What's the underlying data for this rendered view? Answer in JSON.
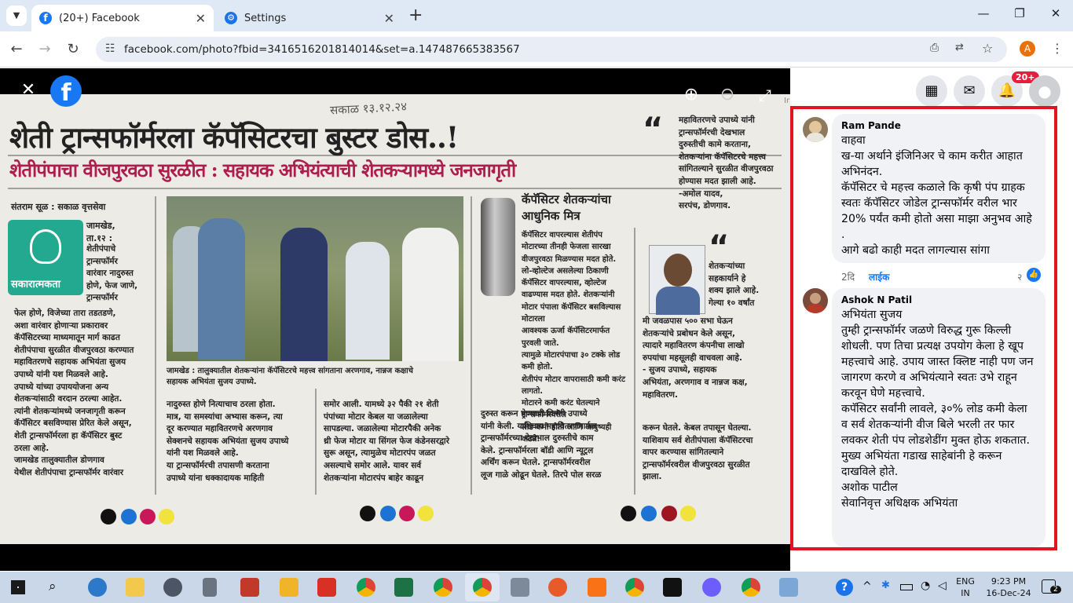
{
  "browser": {
    "tabs": [
      {
        "title": "(20+) Facebook",
        "close": "✕"
      },
      {
        "title": "Settings",
        "close": "✕"
      }
    ],
    "new_tab": "+",
    "url": "facebook.com/photo?fbid=3416516201814014&set=a.147487665383567",
    "profile_initial": "A",
    "window_controls": [
      "—",
      "❐",
      "✕"
    ]
  },
  "viewer": {
    "close": "✕",
    "zoom_in": "⊕",
    "zoom_out": "⊖",
    "expand": "⤢",
    "brand": "f",
    "side_text": "Ir"
  },
  "newspaper": {
    "handwriting": "सकाळ १३.१२.२४",
    "headline": "शेती ट्रान्सफॉर्मरला कॅपॅसिटरचा बुस्टर डोस..!",
    "subheadline": "शेतीपंपाचा वीजपुरवठा सुरळीत : सहायक अभियंत्याची शेतकऱ्यामध्ये जनजागृती",
    "byline": "संतराम सूळ : सकाळ वृत्तसेवा",
    "badge_label": "सकारात्मकता",
    "place": "जामखेड,\nता.१२ :",
    "col1_top": "शेतीपंपाचे\nट्रान्सफॉर्मर\nवारंवार नादुरुस्त\nहोणे, फेज जाणे,\nट्रान्सफॉर्मर",
    "col1_body": "फेल होणे, विजेच्या तारा तडतडणे,\nअशा वारंवार होणाऱ्या प्रकारावर\nकॅपॅसिटरच्या माध्यमातून मार्ग काढत\nशेतीपंपाचा सुरळीत वीजपुरवठा करण्यात\nमहावितरणचे सहायक अभियंता सुजय\nउपाध्ये यांनी यश मिळवले आहे.\nउपाध्ये यांच्या उपाययोजना अन्य\nशेतकऱ्यांसाठी वरदान ठरल्या आहेत.\nत्यांनी शेतकऱ्यांमध्ये जनजागृती करून\nकॅपॅसिटर बसविण्यास प्रेरित केले असून,\nशेती ट्रान्सफॉर्मरला हा कॅपॅसिटर बुस्ट\nठरला आहे.\n   जामखेड तालुक्यातील डोणगाव\nयेथील शेतीपंपाचा ट्रान्सफॉर्मर वारंवार",
    "photo_caption": "जामखेड : तालुक्यातील शेतकऱ्यांना कॅपॅसिटरचे महत्त्व सांगताना अरणगाव, नान्नज कक्षाचे\nसहायक अभियंता सुजय उपाध्ये.",
    "col2_bottom": "नादुरुस्त होणे नित्याचाच ठरला होता.\nमात्र, या समस्यांचा अभ्यास करून, त्या\nदूर करण्यात महावितरणचे अरणगाव\nसेक्शनचे सहायक अभियंता सुजय उपाध्ये\nयांनी यश मिळवले आहे.\n   या ट्रान्सफॉर्मरची तपासणी करताना\nउपाध्ये यांना धक्कादायक माहिती",
    "col3_bottom": "समोर आली. यामध्ये ३२ पैकी २१ शेती\nपंपांच्या मोटार केबल या जळालेल्या\nसापडल्या. जळालेल्या मोटारपैकी अनेक\nथ्री फेज मोटार या सिंगल फेज कंडेनसरद्वारे\nसुरू असून, त्यामुळेच मोटारपंप जळत\nअसल्याचे समोर आले. यावर सर्व\nशेतकऱ्यांना मोटारपंप बाहेर काढून",
    "box_title": "कॅपॅसिटर शेतकऱ्यांचा\nआधुनिक मित्र",
    "box_body": "कॅपॅसिटर वापरल्यास शेतीपंप\nमोटारच्या तीनही फेजला सारखा\nवीजपुरवठा मिळण्यास मदत होते.\nलो-व्होल्टेज असलेल्या ठिकाणी\nकॅपॅसिटर वापरल्यास, व्होल्टेज\nवाढण्यास मदत होते. शेतकऱ्यांनी\nमोटार पंपाला कॅपॅसिटर बसविल्यास मोटारला\nआवश्यक ऊर्जा कॅपॅसिटरमार्फत पुरवली जाते.\nत्यामुळे मोटारपंपाचा ३० टक्के लोड कमी होतो.\nशेतीपंप मोटार वापरासाठी कमी करंट लागतो.\nमोटारने कमी करंट घेतल्याने ट्रान्सफॉर्मरवरील\nलोड कमी होतो आणि आयुष्यही वाढते.",
    "col4_bottom": "दुरुस्त करून घेण्याची विनंती उपाध्ये\nयांनी केली. याशिवाय महावितरणमार्फत\nट्रान्सफॉर्मरच्या देखभाल दुरुस्तीचे काम\nकेले. ट्रान्सफॉर्मरला बॉडी आणि न्यूट्रल\nअर्थिंग करून घेतले. ट्रान्सफॉर्मरवरील\nलूज गाळे ओढून घेतले. तिरपे पोल सरळ",
    "quote1": "महावितरणचे उपाध्ये यांनी\nट्रान्सफॉर्मरची देखभाल\nदुरुस्तीची कामे करताना,\nशेतकऱ्यांना कॅपॅसिटरचे महत्त्व\nसांगितल्याने सुरळीत वीजपुरवठा\nहोण्यास मदत झाली आहे.\n-अमोल यादव,\nसरपंच, डोणगाव.",
    "quote2_side": "शेतकऱ्यांच्या\nसहकार्याने हे\nशक्य झाले आहे.\nगेल्या १० वर्षांत",
    "quote2_body": "मी जवळपास ५०० सभा घेऊन\nशेतकऱ्यांचे प्रबोधन केले असून,\nत्यादारे महावितरण कंपनीचा लाखो\nरुपयांचा महसूलही वाचवला आहे.\n- सुजय उपाध्ये, सहायक\nअभियंता, अरणगाव व नान्नज कक्ष,\nमहावितरण.",
    "col5_bottom": "करून घेतले. केबल तपासून घेतल्या.\nयाशिवाय सर्व शेतीपंपाला कॅपॅसिटरचा\nवापर करण्यास सांगितल्याने\nट्रान्सफॉर्मरवरील वीजपुरवठा सुरळीत\nझाला."
  },
  "header": {
    "notif_badge": "20+",
    "icons": [
      "menu-grid-icon",
      "messenger-icon",
      "bell-icon",
      "profile-icon"
    ]
  },
  "comments": [
    {
      "name": "Ram Pande",
      "body": "वाहवा\nख-या अर्थाने इंजिनिअर चे काम करीत आहात अभिनंदन.\nकॅपॅसिटर चे महत्त्व कळाले कि कृषी पंप ग्राहक स्वतः कॅपॅसिटर जोडेल ट्रान्सफॉर्मर वरील भार 20% पर्यंत कमी होतो असा माझा अनुभव आहे .\nआगे बढो काही मदत लागल्यास सांगा",
      "time": "2दि",
      "like": "लाईक",
      "reactions": "२"
    },
    {
      "name": "Ashok N Patil",
      "body": "अभियंता सुजय\nतुम्ही ट्रान्सफॉर्मर जळणे विरुद्ध गुरू किल्ली शोधली. पण तिचा प्रत्यक्ष उपयोग केला हे खूप महत्त्वाचे आहे. उपाय जास्त क्लिष्ट नाही पण जन जागरण करणे व अभियंत्याने स्वतः उभे राहून करवून घेणे महत्त्वाचे.\nकपॅसिटर सर्वांनी लावले, ३०% लोड कमी केला व सर्व शेतकऱ्यांनी वीज बिले भरली तर फार लवकर शेती पंप लोडशेडींग मुक्त होऊ शकतात.\nमुख्य अभियंता गडाख साहेबांनी हे करून दाखविले होते.\nअशोक पाटील\nसेवानिवृत्त अधिक्षक अभियंता"
    }
  ],
  "taskbar": {
    "tray_lang_1": "ENG",
    "tray_lang_2": "IN",
    "time": "9:23 PM",
    "date": "16-Dec-24",
    "notification_count": "2",
    "help": "?",
    "chevron": "^"
  }
}
